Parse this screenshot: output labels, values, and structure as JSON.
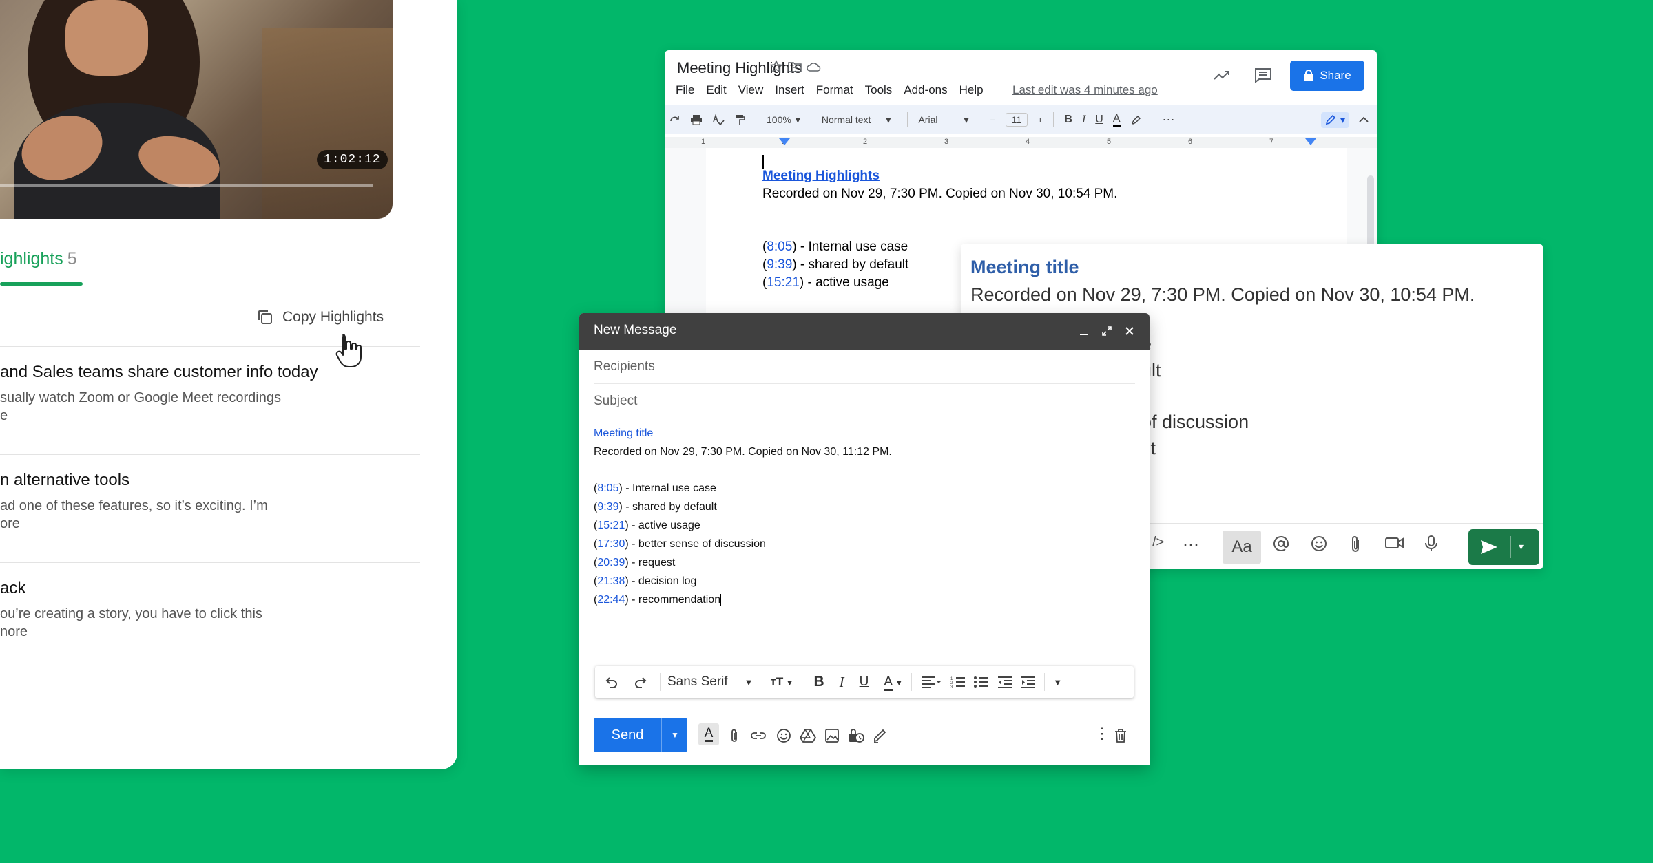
{
  "left_panel": {
    "video_time": "1:02:12",
    "highlights_tab_label": "ighlights",
    "highlights_count": "5",
    "copy_highlights_label": "Copy Highlights",
    "items": [
      {
        "title": "and Sales teams share customer info today",
        "line1": "sually watch Zoom or Google Meet recordings",
        "line2": "e"
      },
      {
        "title": "n alternative tools",
        "line1": "ad one of these features, so it’s exciting. I’m",
        "line2": "ore"
      },
      {
        "title": "ack",
        "line1": "ou’re creating a story, you have to click this",
        "line2": "nore"
      }
    ]
  },
  "doc": {
    "title": "Meeting Highlights",
    "menu": [
      "File",
      "Edit",
      "View",
      "Insert",
      "Format",
      "Tools",
      "Add-ons",
      "Help"
    ],
    "last_edit": "Last edit was 4 minutes ago",
    "share_label": "Share",
    "toolbar": {
      "zoom": "100%",
      "style": "Normal text",
      "font": "Arial",
      "size": "11"
    },
    "ruler": [
      "1",
      "1",
      "2",
      "3",
      "4",
      "5",
      "6",
      "7"
    ],
    "heading": "Meeting Highlights",
    "recorded": "Recorded on Nov 29, 7:30 PM. Copied on Nov 30, 10:54 PM.",
    "highlights": [
      {
        "time": "8:05",
        "text": ") - Internal use case"
      },
      {
        "time": "9:39",
        "text": ") - shared by default"
      },
      {
        "time": "15:21",
        "text": ") - active usage"
      }
    ]
  },
  "right_card": {
    "title": "Meeting title",
    "recorded": "Recorded on Nov 29, 7:30 PM. Copied on Nov 30, 10:54 PM.",
    "fragments": [
      "e",
      "ult",
      "of discussion",
      "st"
    ],
    "aa_label": "Aa"
  },
  "compose": {
    "title": "New Message",
    "recipients_placeholder": "Recipients",
    "subject_placeholder": "Subject",
    "meeting_title": "Meeting title",
    "recorded": "Recorded on Nov 29, 7:30 PM. Copied on Nov 30, 11:12 PM.",
    "highlights": [
      {
        "time": "8:05",
        "text": ") - Internal use case"
      },
      {
        "time": "9:39",
        "text": ") - shared by default"
      },
      {
        "time": "15:21",
        "text": ") - active usage"
      },
      {
        "time": "17:30",
        "text": ") - better sense of discussion"
      },
      {
        "time": "20:39",
        "text": ") - request"
      },
      {
        "time": "21:38",
        "text": ") - decision log"
      },
      {
        "time": "22:44",
        "text": ") - recommendation"
      }
    ],
    "font_label": "Sans Serif",
    "send_label": "Send"
  },
  "colors": {
    "background": "#02b76a",
    "accent_green": "#18a15a",
    "gmail_blue": "#1a73e8",
    "link_blue": "#1a56db"
  }
}
